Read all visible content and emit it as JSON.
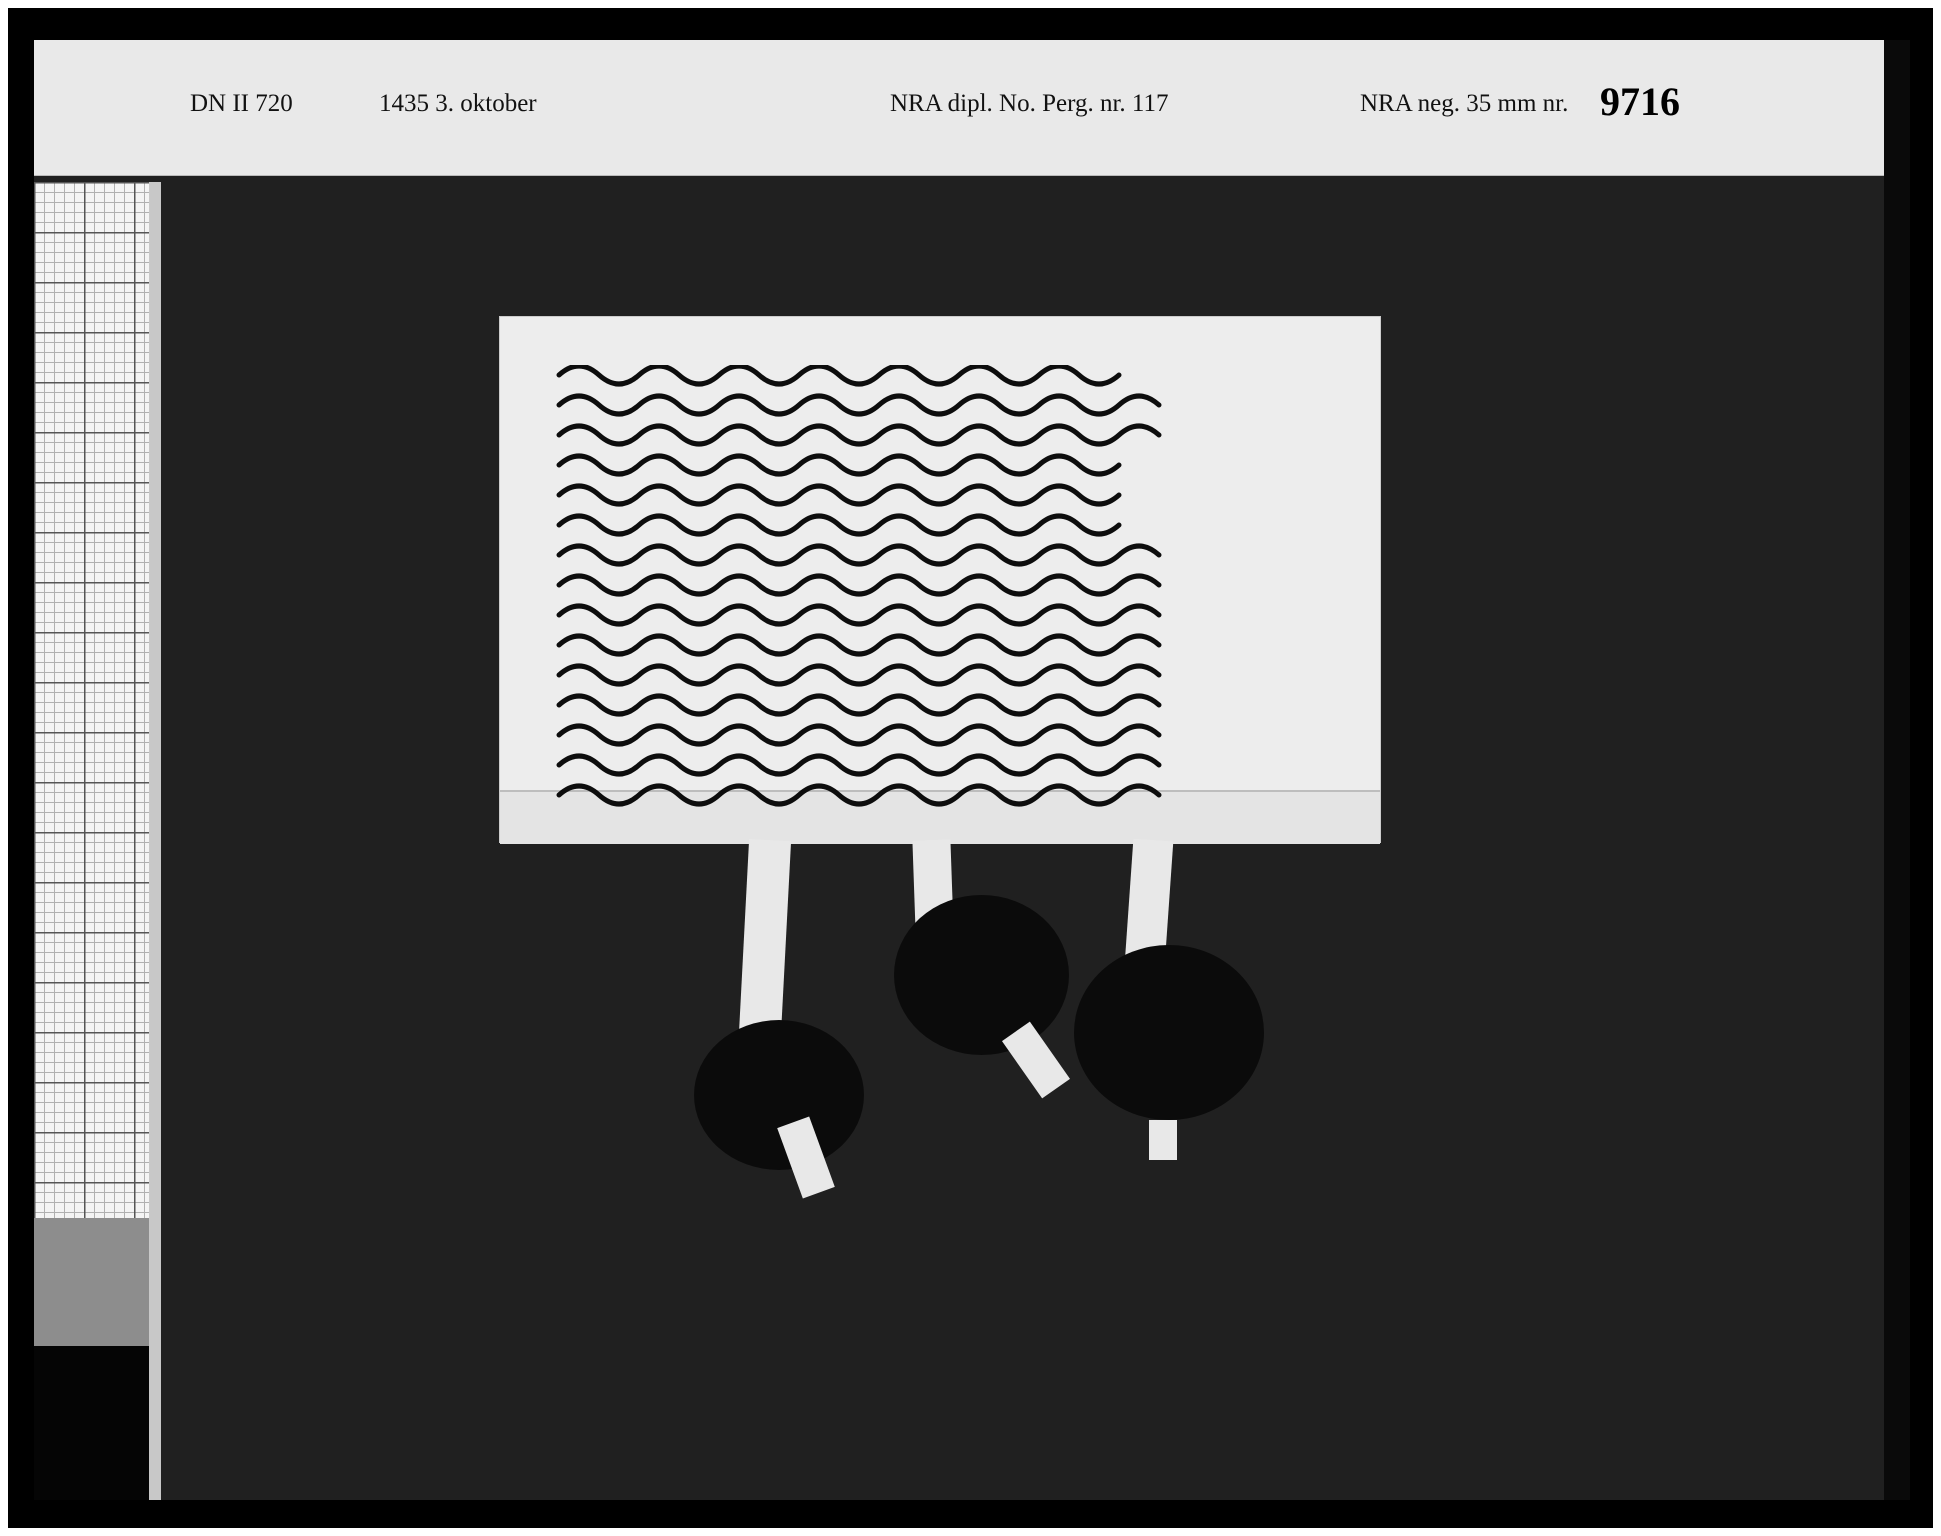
{
  "label": {
    "ref": "DN II 720",
    "date": "1435  3. oktober",
    "archive": "NRA dipl. No. Perg. nr. 117",
    "negative_prefix": "NRA neg. 35 mm nr.",
    "negative_number": "9716"
  }
}
